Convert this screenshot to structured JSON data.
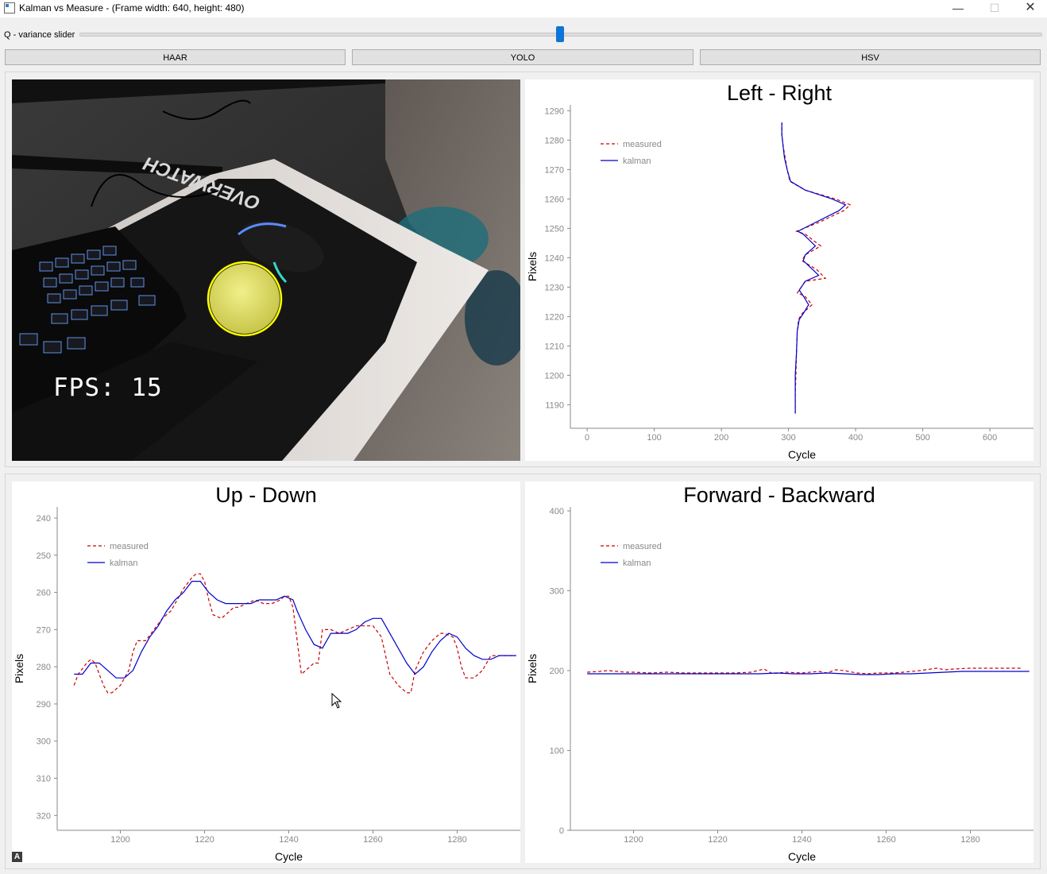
{
  "window": {
    "title": "Kalman vs Measure - (Frame width: 640, height: 480)",
    "minimize": "—",
    "maximize": "☐",
    "close": "✕"
  },
  "slider": {
    "label": "Q - variance slider",
    "value_fraction": 0.5
  },
  "buttons": {
    "haar": "HAAR",
    "yolo": "YOLO",
    "hsv": "HSV"
  },
  "camera": {
    "fps_text": "FPS: 15",
    "mousepad_brand": "OVERWATCH",
    "detection_color": "#ffff00"
  },
  "colors": {
    "measured": "#cc0000",
    "kalman": "#0000cc",
    "slider_accent": "#0f74d6"
  },
  "chart_data": [
    {
      "id": "left_right",
      "type": "line",
      "title": "Left - Right",
      "xlabel": "Cycle",
      "ylabel": "Pixels",
      "xlim": [
        -25,
        665
      ],
      "ylim": [
        1182,
        1292
      ],
      "xticks": [
        0,
        100,
        200,
        300,
        400,
        500,
        600
      ],
      "yticks": [
        1190,
        1200,
        1210,
        1220,
        1230,
        1240,
        1250,
        1260,
        1270,
        1280,
        1290
      ],
      "legend": [
        "measured",
        "kalman"
      ],
      "legend_position": "top-left",
      "series": [
        {
          "name": "measured",
          "style": "dashed",
          "points": [
            [
              310,
              1187
            ],
            [
              310,
              1194
            ],
            [
              311,
              1200
            ],
            [
              312,
              1208
            ],
            [
              313,
              1215
            ],
            [
              315,
              1219
            ],
            [
              320,
              1221
            ],
            [
              335,
              1224
            ],
            [
              324,
              1227
            ],
            [
              313,
              1228
            ],
            [
              325,
              1232
            ],
            [
              355,
              1233
            ],
            [
              342,
              1236
            ],
            [
              320,
              1239
            ],
            [
              325,
              1241
            ],
            [
              348,
              1244
            ],
            [
              325,
              1248
            ],
            [
              312,
              1249
            ],
            [
              345,
              1252
            ],
            [
              382,
              1256
            ],
            [
              392,
              1258
            ],
            [
              370,
              1260
            ],
            [
              325,
              1263
            ],
            [
              302,
              1266
            ],
            [
              298,
              1270
            ],
            [
              295,
              1274
            ],
            [
              292,
              1278
            ],
            [
              290,
              1282
            ],
            [
              290,
              1286
            ]
          ]
        },
        {
          "name": "kalman",
          "style": "solid",
          "points": [
            [
              310,
              1187
            ],
            [
              310,
              1194
            ],
            [
              310,
              1200
            ],
            [
              312,
              1208
            ],
            [
              313,
              1215
            ],
            [
              316,
              1219
            ],
            [
              322,
              1221
            ],
            [
              330,
              1224
            ],
            [
              322,
              1227
            ],
            [
              316,
              1229
            ],
            [
              325,
              1232
            ],
            [
              345,
              1234
            ],
            [
              336,
              1236
            ],
            [
              322,
              1239
            ],
            [
              325,
              1241
            ],
            [
              340,
              1244
            ],
            [
              322,
              1248
            ],
            [
              314,
              1249
            ],
            [
              340,
              1252
            ],
            [
              375,
              1256
            ],
            [
              385,
              1258
            ],
            [
              365,
              1260
            ],
            [
              325,
              1263
            ],
            [
              303,
              1266
            ],
            [
              298,
              1270
            ],
            [
              294,
              1274
            ],
            [
              292,
              1278
            ],
            [
              290,
              1282
            ],
            [
              290,
              1286
            ]
          ]
        }
      ]
    },
    {
      "id": "up_down",
      "type": "line",
      "title": "Up - Down",
      "xlabel": "Cycle",
      "ylabel": "Pixels",
      "xlim": [
        1185,
        1295
      ],
      "ylim": [
        324,
        237
      ],
      "xticks": [
        1200,
        1220,
        1240,
        1260,
        1280
      ],
      "yticks": [
        240,
        250,
        260,
        270,
        280,
        290,
        300,
        310,
        320
      ],
      "legend": [
        "measured",
        "kalman"
      ],
      "legend_position": "top-left",
      "series": [
        {
          "name": "measured",
          "style": "dashed",
          "points": [
            [
              1189,
              285
            ],
            [
              1190,
              282
            ],
            [
              1192,
              279
            ],
            [
              1193,
              278
            ],
            [
              1194,
              279
            ],
            [
              1196,
              285
            ],
            [
              1197,
              287
            ],
            [
              1198,
              287
            ],
            [
              1200,
              285
            ],
            [
              1202,
              281
            ],
            [
              1203,
              276
            ],
            [
              1204,
              273
            ],
            [
              1206,
              273
            ],
            [
              1208,
              270
            ],
            [
              1210,
              267
            ],
            [
              1212,
              265
            ],
            [
              1213,
              263
            ],
            [
              1215,
              259
            ],
            [
              1217,
              256
            ],
            [
              1218,
              255
            ],
            [
              1219,
              255
            ],
            [
              1220,
              257
            ],
            [
              1221,
              262
            ],
            [
              1222,
              266
            ],
            [
              1224,
              267
            ],
            [
              1225,
              266
            ],
            [
              1227,
              264
            ],
            [
              1228,
              264
            ],
            [
              1230,
              263
            ],
            [
              1232,
              262
            ],
            [
              1234,
              263
            ],
            [
              1236,
              263
            ],
            [
              1238,
              262
            ],
            [
              1239,
              261
            ],
            [
              1240,
              261
            ],
            [
              1241,
              264
            ],
            [
              1242,
              273
            ],
            [
              1243,
              282
            ],
            [
              1245,
              280
            ],
            [
              1246,
              279
            ],
            [
              1247,
              279
            ],
            [
              1248,
              270
            ],
            [
              1250,
              270
            ],
            [
              1252,
              271
            ],
            [
              1254,
              270
            ],
            [
              1256,
              269
            ],
            [
              1258,
              269
            ],
            [
              1260,
              269
            ],
            [
              1262,
              272
            ],
            [
              1264,
              282
            ],
            [
              1266,
              285
            ],
            [
              1268,
              287
            ],
            [
              1269,
              287
            ],
            [
              1270,
              281
            ],
            [
              1272,
              276
            ],
            [
              1274,
              273
            ],
            [
              1276,
              271
            ],
            [
              1277,
              271
            ],
            [
              1279,
              272
            ],
            [
              1280,
              275
            ],
            [
              1281,
              280
            ],
            [
              1282,
              283
            ],
            [
              1284,
              283
            ],
            [
              1286,
              281
            ],
            [
              1288,
              277
            ],
            [
              1290,
              277
            ],
            [
              1292,
              277
            ],
            [
              1294,
              277
            ]
          ]
        },
        {
          "name": "kalman",
          "style": "solid",
          "points": [
            [
              1189,
              282
            ],
            [
              1191,
              282
            ],
            [
              1193,
              279
            ],
            [
              1195,
              279
            ],
            [
              1197,
              281
            ],
            [
              1199,
              283
            ],
            [
              1201,
              283
            ],
            [
              1203,
              281
            ],
            [
              1205,
              276
            ],
            [
              1207,
              272
            ],
            [
              1209,
              269
            ],
            [
              1211,
              265
            ],
            [
              1213,
              262
            ],
            [
              1215,
              260
            ],
            [
              1217,
              257
            ],
            [
              1219,
              257
            ],
            [
              1221,
              260
            ],
            [
              1223,
              262
            ],
            [
              1225,
              263
            ],
            [
              1227,
              263
            ],
            [
              1229,
              263
            ],
            [
              1231,
              263
            ],
            [
              1233,
              262
            ],
            [
              1235,
              262
            ],
            [
              1237,
              262
            ],
            [
              1239,
              261
            ],
            [
              1241,
              262
            ],
            [
              1242,
              265
            ],
            [
              1244,
              270
            ],
            [
              1246,
              274
            ],
            [
              1248,
              275
            ],
            [
              1250,
              271
            ],
            [
              1252,
              271
            ],
            [
              1254,
              271
            ],
            [
              1256,
              270
            ],
            [
              1258,
              268
            ],
            [
              1260,
              267
            ],
            [
              1262,
              267
            ],
            [
              1264,
              271
            ],
            [
              1266,
              275
            ],
            [
              1268,
              279
            ],
            [
              1270,
              282
            ],
            [
              1272,
              280
            ],
            [
              1274,
              276
            ],
            [
              1276,
              273
            ],
            [
              1278,
              271
            ],
            [
              1280,
              272
            ],
            [
              1282,
              275
            ],
            [
              1284,
              277
            ],
            [
              1286,
              278
            ],
            [
              1288,
              278
            ],
            [
              1290,
              277
            ],
            [
              1292,
              277
            ],
            [
              1294,
              277
            ]
          ]
        }
      ]
    },
    {
      "id": "forward_backward",
      "type": "line",
      "title": "Forward - Backward",
      "xlabel": "Cycle",
      "ylabel": "Pixels",
      "xlim": [
        1185,
        1295
      ],
      "ylim": [
        0,
        405
      ],
      "xticks": [
        1200,
        1220,
        1240,
        1260,
        1280
      ],
      "yticks": [
        0,
        100,
        200,
        300,
        400
      ],
      "legend": [
        "measured",
        "kalman"
      ],
      "legend_position": "top-left",
      "series": [
        {
          "name": "measured",
          "style": "dashed",
          "points": [
            [
              1189,
              198
            ],
            [
              1192,
              199
            ],
            [
              1194,
              200
            ],
            [
              1196,
              199
            ],
            [
              1198,
              198
            ],
            [
              1200,
              198
            ],
            [
              1204,
              197
            ],
            [
              1208,
              198
            ],
            [
              1212,
              197
            ],
            [
              1216,
              197
            ],
            [
              1220,
              197
            ],
            [
              1224,
              197
            ],
            [
              1228,
              198
            ],
            [
              1231,
              202
            ],
            [
              1233,
              196
            ],
            [
              1236,
              198
            ],
            [
              1240,
              197
            ],
            [
              1244,
              199
            ],
            [
              1246,
              197
            ],
            [
              1248,
              201
            ],
            [
              1250,
              200
            ],
            [
              1253,
              197
            ],
            [
              1256,
              196
            ],
            [
              1258,
              197
            ],
            [
              1262,
              197
            ],
            [
              1266,
              199
            ],
            [
              1268,
              200
            ],
            [
              1272,
              203
            ],
            [
              1274,
              201
            ],
            [
              1276,
              202
            ],
            [
              1280,
              203
            ],
            [
              1284,
              203
            ],
            [
              1288,
              203
            ],
            [
              1292,
              203
            ]
          ]
        },
        {
          "name": "kalman",
          "style": "solid",
          "points": [
            [
              1189,
              196
            ],
            [
              1194,
              196
            ],
            [
              1200,
              196
            ],
            [
              1206,
              196
            ],
            [
              1212,
              196
            ],
            [
              1218,
              196
            ],
            [
              1224,
              196
            ],
            [
              1230,
              196
            ],
            [
              1234,
              197
            ],
            [
              1238,
              196
            ],
            [
              1242,
              196
            ],
            [
              1246,
              197
            ],
            [
              1250,
              196
            ],
            [
              1254,
              195
            ],
            [
              1258,
              195
            ],
            [
              1262,
              196
            ],
            [
              1266,
              196
            ],
            [
              1270,
              197
            ],
            [
              1274,
              198
            ],
            [
              1278,
              199
            ],
            [
              1282,
              199
            ],
            [
              1286,
              199
            ],
            [
              1290,
              199
            ],
            [
              1294,
              199
            ]
          ]
        }
      ]
    }
  ]
}
